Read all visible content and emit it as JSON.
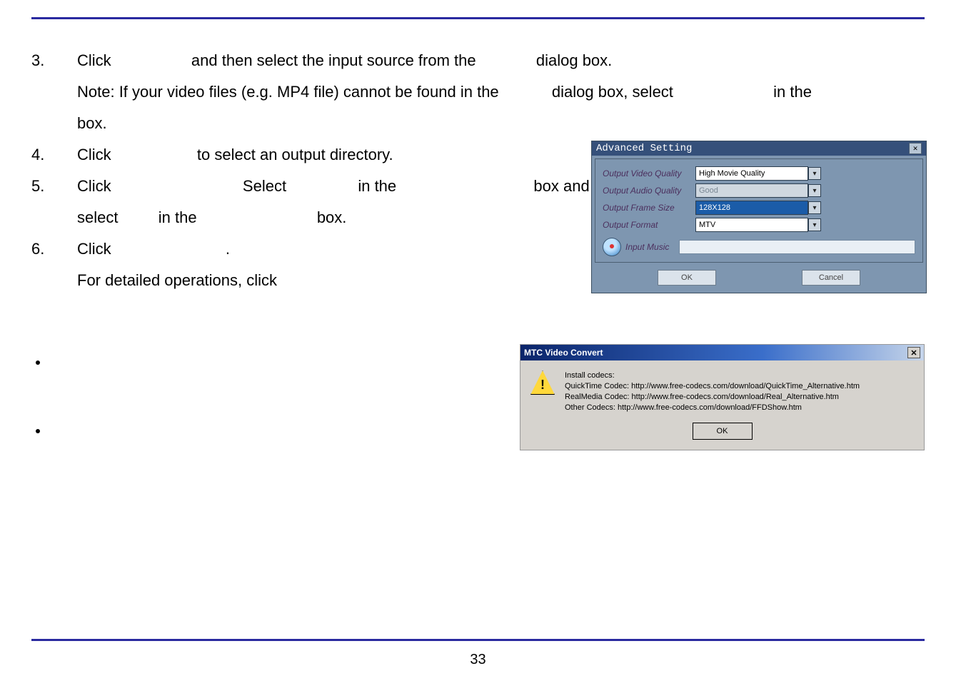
{
  "steps": {
    "s3": {
      "num": "3.",
      "a": "Click",
      "b": "and then select the input source from the",
      "c": "dialog box."
    },
    "s3b": {
      "a": "Note: If your video files (e.g. MP4 file) cannot be found in the",
      "b": "dialog box, select",
      "c": "in the",
      "d": "box."
    },
    "s4": {
      "num": "4.",
      "a": "Click",
      "b": "to select an output directory."
    },
    "s5": {
      "num": "5.",
      "a": "Click",
      "b": "Select",
      "c": "in the",
      "d": "box and"
    },
    "s5b": {
      "a": "select",
      "b": "in the",
      "c": "box."
    },
    "s6": {
      "num": "6.",
      "a": "Click",
      "b": "."
    },
    "s6b": {
      "a": "For detailed operations, click"
    }
  },
  "adv": {
    "title": "Advanced Setting",
    "rows": {
      "vq": {
        "label": "Output Video Quality",
        "value": "High Movie Quality"
      },
      "aq": {
        "label": "Output Audio Quality",
        "value": "Good"
      },
      "fs": {
        "label": "Output Frame Size",
        "value": "128X128"
      },
      "fmt": {
        "label": "Output Format",
        "value": "MTV"
      }
    },
    "input_music": "Input Music",
    "ok": "OK",
    "cancel": "Cancel"
  },
  "mtc": {
    "title": "MTC Video Convert",
    "heading": "Install codecs:",
    "line1": "QuickTime Codec: http://www.free-codecs.com/download/QuickTime_Alternative.htm",
    "line2": "RealMedia Codec: http://www.free-codecs.com/download/Real_Alternative.htm",
    "line3": "Other Codecs: http://www.free-codecs.com/download/FFDShow.htm",
    "ok": "OK"
  },
  "page_number": "33"
}
